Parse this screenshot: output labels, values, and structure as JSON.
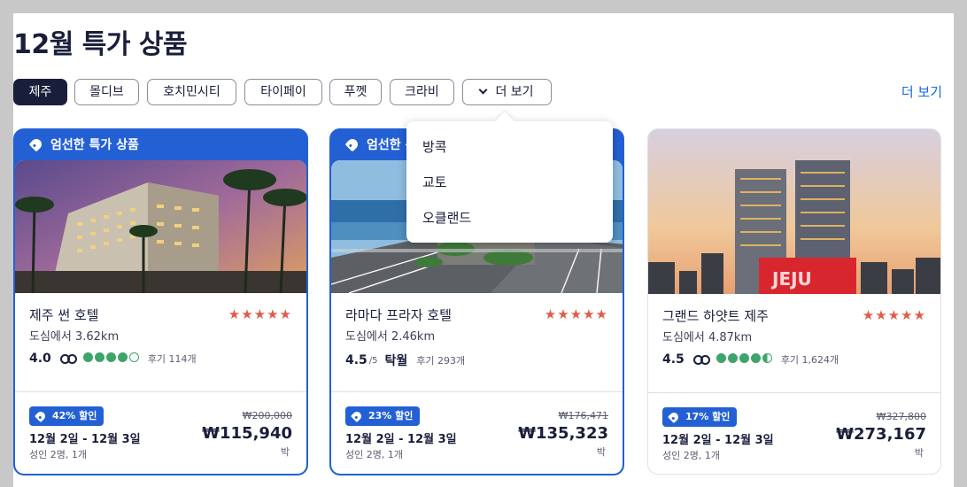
{
  "title": "12월 특가 상품",
  "filters": [
    "제주",
    "몰디브",
    "호치민시티",
    "타이페이",
    "푸껫",
    "크라비"
  ],
  "more_filter_label": "더 보기",
  "more_link": "더 보기",
  "dropdown_items": [
    "방콕",
    "교토",
    "오클랜드"
  ],
  "featured_banner": "엄선한 특가 상품",
  "cards": [
    {
      "name": "제주 썬 호텔",
      "stars": "★★★★★",
      "distance": "도심에서 3.62km",
      "rating": "4.0",
      "reviews": "후기 114개",
      "discount": "42% 할인",
      "dates": "12월 2일 - 12월 3일",
      "guests": "성인 2명, 1개",
      "old_price": "₩200,000",
      "price": "₩115,940",
      "unit": "박"
    },
    {
      "name": "라마다 프라자 호텔",
      "stars": "★★★★★",
      "distance": "도심에서 2.46km",
      "rating": "4.5",
      "rating_scale": "/5",
      "rating_word": "탁월",
      "reviews": "후기 293개",
      "discount": "23% 할인",
      "dates": "12월 2일 - 12월 3일",
      "guests": "성인 2명, 1개",
      "old_price": "₩176,471",
      "price": "₩135,323",
      "unit": "박"
    },
    {
      "name": "그랜드 하얏트 제주",
      "stars": "★★★★★",
      "distance": "도심에서 4.87km",
      "rating": "4.5",
      "reviews": "후기 1,624개",
      "discount": "17% 할인",
      "dates": "12월 2일 - 12월 3일",
      "guests": "성인 2명, 1개",
      "old_price": "₩327,800",
      "price": "₩273,167",
      "unit": "박"
    }
  ],
  "colors": {
    "accent": "#2360d4",
    "link": "#1668e3",
    "stars": "#e05c4a",
    "tripadvisor": "#3da56a",
    "active_chip": "#191e3b"
  }
}
